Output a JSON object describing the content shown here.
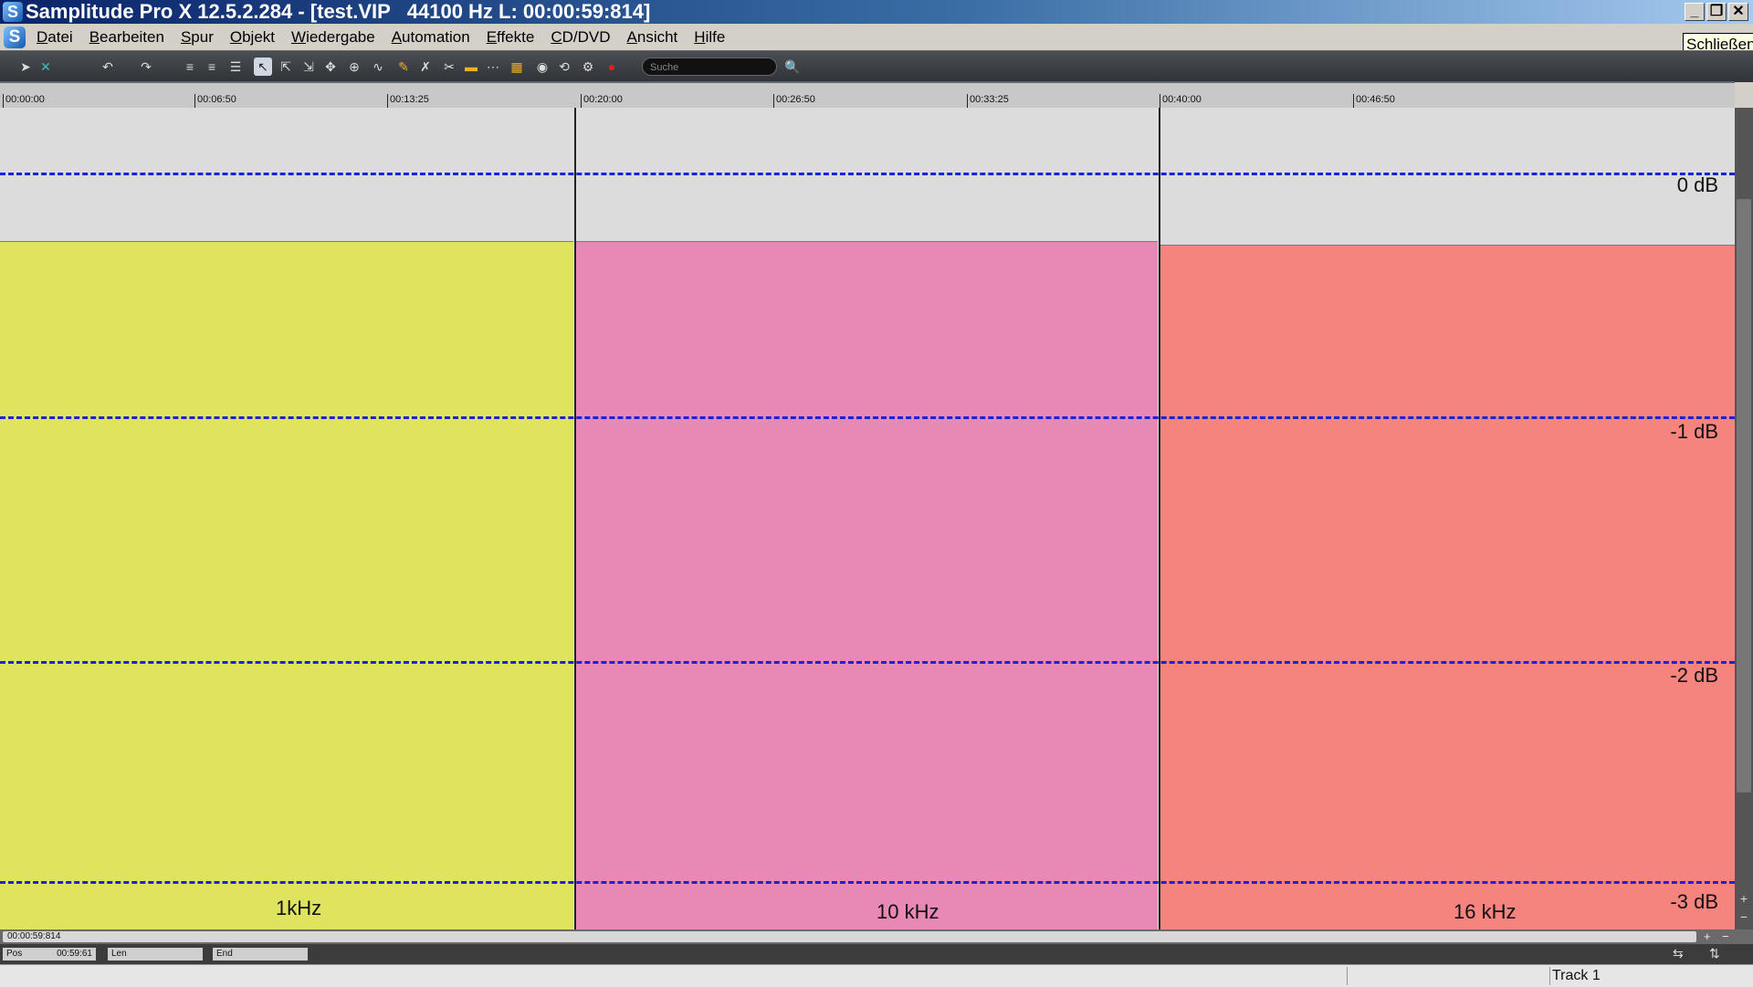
{
  "window": {
    "title": "Samplitude Pro X 12.5.2.284 - [test.VIP   44100 Hz L: 00:00:59:814]",
    "app_icon_letter": "S",
    "minimize_glyph": "_",
    "restore_glyph": "❐",
    "close_glyph": "✕",
    "close_tooltip": "Schließen"
  },
  "menu": {
    "items": [
      "Datei",
      "Bearbeiten",
      "Spur",
      "Objekt",
      "Wiedergabe",
      "Automation",
      "Effekte",
      "CD/DVD",
      "Ansicht",
      "Hilfe"
    ]
  },
  "toolbar": {
    "search_placeholder": "Suche",
    "tools": [
      {
        "name": "pointer-icon",
        "glyph": "➤"
      },
      {
        "name": "crossfade-icon",
        "glyph": "✕"
      },
      {
        "name": "undo-icon",
        "glyph": "↶"
      },
      {
        "name": "redo-icon",
        "glyph": "↷"
      },
      {
        "name": "object-mode-icon",
        "glyph": "≡"
      },
      {
        "name": "range-mode-icon",
        "glyph": "≡"
      },
      {
        "name": "list-mode-icon",
        "glyph": "☰"
      },
      {
        "name": "select-tool-icon",
        "glyph": "↖"
      },
      {
        "name": "range-tool-icon",
        "glyph": "⇱"
      },
      {
        "name": "split-tool-icon",
        "glyph": "⇲"
      },
      {
        "name": "scrub-tool-icon",
        "glyph": "✥"
      },
      {
        "name": "zoom-tool-icon",
        "glyph": "⊕"
      },
      {
        "name": "curve-tool-icon",
        "glyph": "∿"
      },
      {
        "name": "pencil-icon",
        "glyph": "✎"
      },
      {
        "name": "erase-icon",
        "glyph": "✗"
      },
      {
        "name": "cut-icon",
        "glyph": "✂"
      },
      {
        "name": "glue-icon",
        "glyph": "▬"
      },
      {
        "name": "snap-icon",
        "glyph": "⋯"
      },
      {
        "name": "grid-icon",
        "glyph": "▦"
      },
      {
        "name": "metronome-icon",
        "glyph": "◉"
      },
      {
        "name": "loop-icon",
        "glyph": "⟲"
      },
      {
        "name": "settings-icon",
        "glyph": "⚙"
      },
      {
        "name": "record-icon",
        "glyph": "●"
      }
    ],
    "search_icon": "🔍"
  },
  "ruler": {
    "labels": [
      "00:00:00",
      "00:06:50",
      "00:13:25",
      "00:20:00",
      "00:26:50",
      "00:33:25",
      "00:40:00",
      "00:46:50"
    ]
  },
  "track": {
    "clips": [
      {
        "label": "1kHz",
        "color": "#dfe35e"
      },
      {
        "label": "10 kHz",
        "color": "#e888b5"
      },
      {
        "label": "16 kHz",
        "color": "#f5847f"
      }
    ],
    "db_labels": [
      "0 dB",
      "-1 dB",
      "-2 dB",
      "-3 dB"
    ],
    "grid_color": "#1c22d6"
  },
  "transport": {
    "position_readout": "00:00:59:814",
    "pos_label": "Pos",
    "pos_value": "00:59:61",
    "len_label": "Len",
    "end_label": "End",
    "zoom_in_glyph": "+",
    "zoom_out_glyph": "−"
  },
  "status": {
    "track_name": "Track 1"
  }
}
